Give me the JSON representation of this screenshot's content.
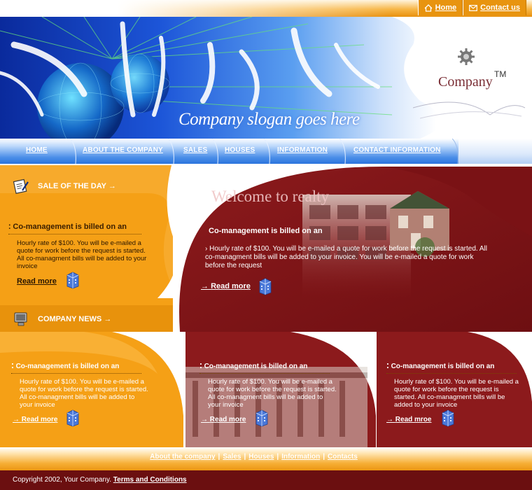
{
  "top_links": [
    {
      "label": "Home",
      "icon": "home-icon"
    },
    {
      "label": "Contact us",
      "icon": "envelope-icon"
    }
  ],
  "banner": {
    "slogan": "Company slogan goes here",
    "logo_text": "Company",
    "logo_mark": "TM"
  },
  "nav": {
    "items": [
      "HOME",
      "ABOUT THE COMPANY",
      "SALES",
      "HOUSES",
      "INFORMATION",
      "CONTACT INFORMATION"
    ]
  },
  "sale_of_the_day": {
    "heading": "SALE OF THE DAY →",
    "item_title": "Co-management is billed on an",
    "item_body": "Hourly rate of $100. You will be e-mailed a quote for work before the request is started. All co-managment bills will be added to your invoice",
    "read_more": "Read more"
  },
  "company_news": {
    "heading": "COMPANY NEWS →"
  },
  "welcome": {
    "title": "Welcome to realty",
    "item_title": "Co-management is billed on an",
    "item_body": "Hourly rate of $100. You will be e-mailed a quote for work before the request is started. All co-managment bills will be added to your invoice. You will be e-mailed a quote for work before the request",
    "read_more": "Read more"
  },
  "news_boxes": [
    {
      "title": "Co-management is billed on an",
      "body": "Hourly rate of $100. You will be e-mailed a quote for work before the request is started. All co-managment bills will be added to your invoice",
      "read_more": "Read more"
    },
    {
      "title": "Co-management is billed on an",
      "body": "Hourly rate of $100. You will be e-mailed a quote for work before the request is started. All co-managment bills will be added to your invoice",
      "read_more": "Read more"
    },
    {
      "title": "Co-management is billed on an",
      "body": "Hourly rate of $100. You will be e-mailed a quote for work before the request is started. All co-managment bills will be added to your invoice",
      "read_more": "Read mroe"
    }
  ],
  "footer": {
    "links": [
      "About the company",
      "Sales",
      "Houses",
      "Information",
      "Contacts"
    ],
    "copyright": "Copyright 2002, Your Company.",
    "terms": "Terms and Conditions"
  },
  "colors": {
    "orange": "#f5a016",
    "maroon": "#8c1a1c",
    "blue": "#2b74dd",
    "dark_footer": "#6b0f10"
  }
}
